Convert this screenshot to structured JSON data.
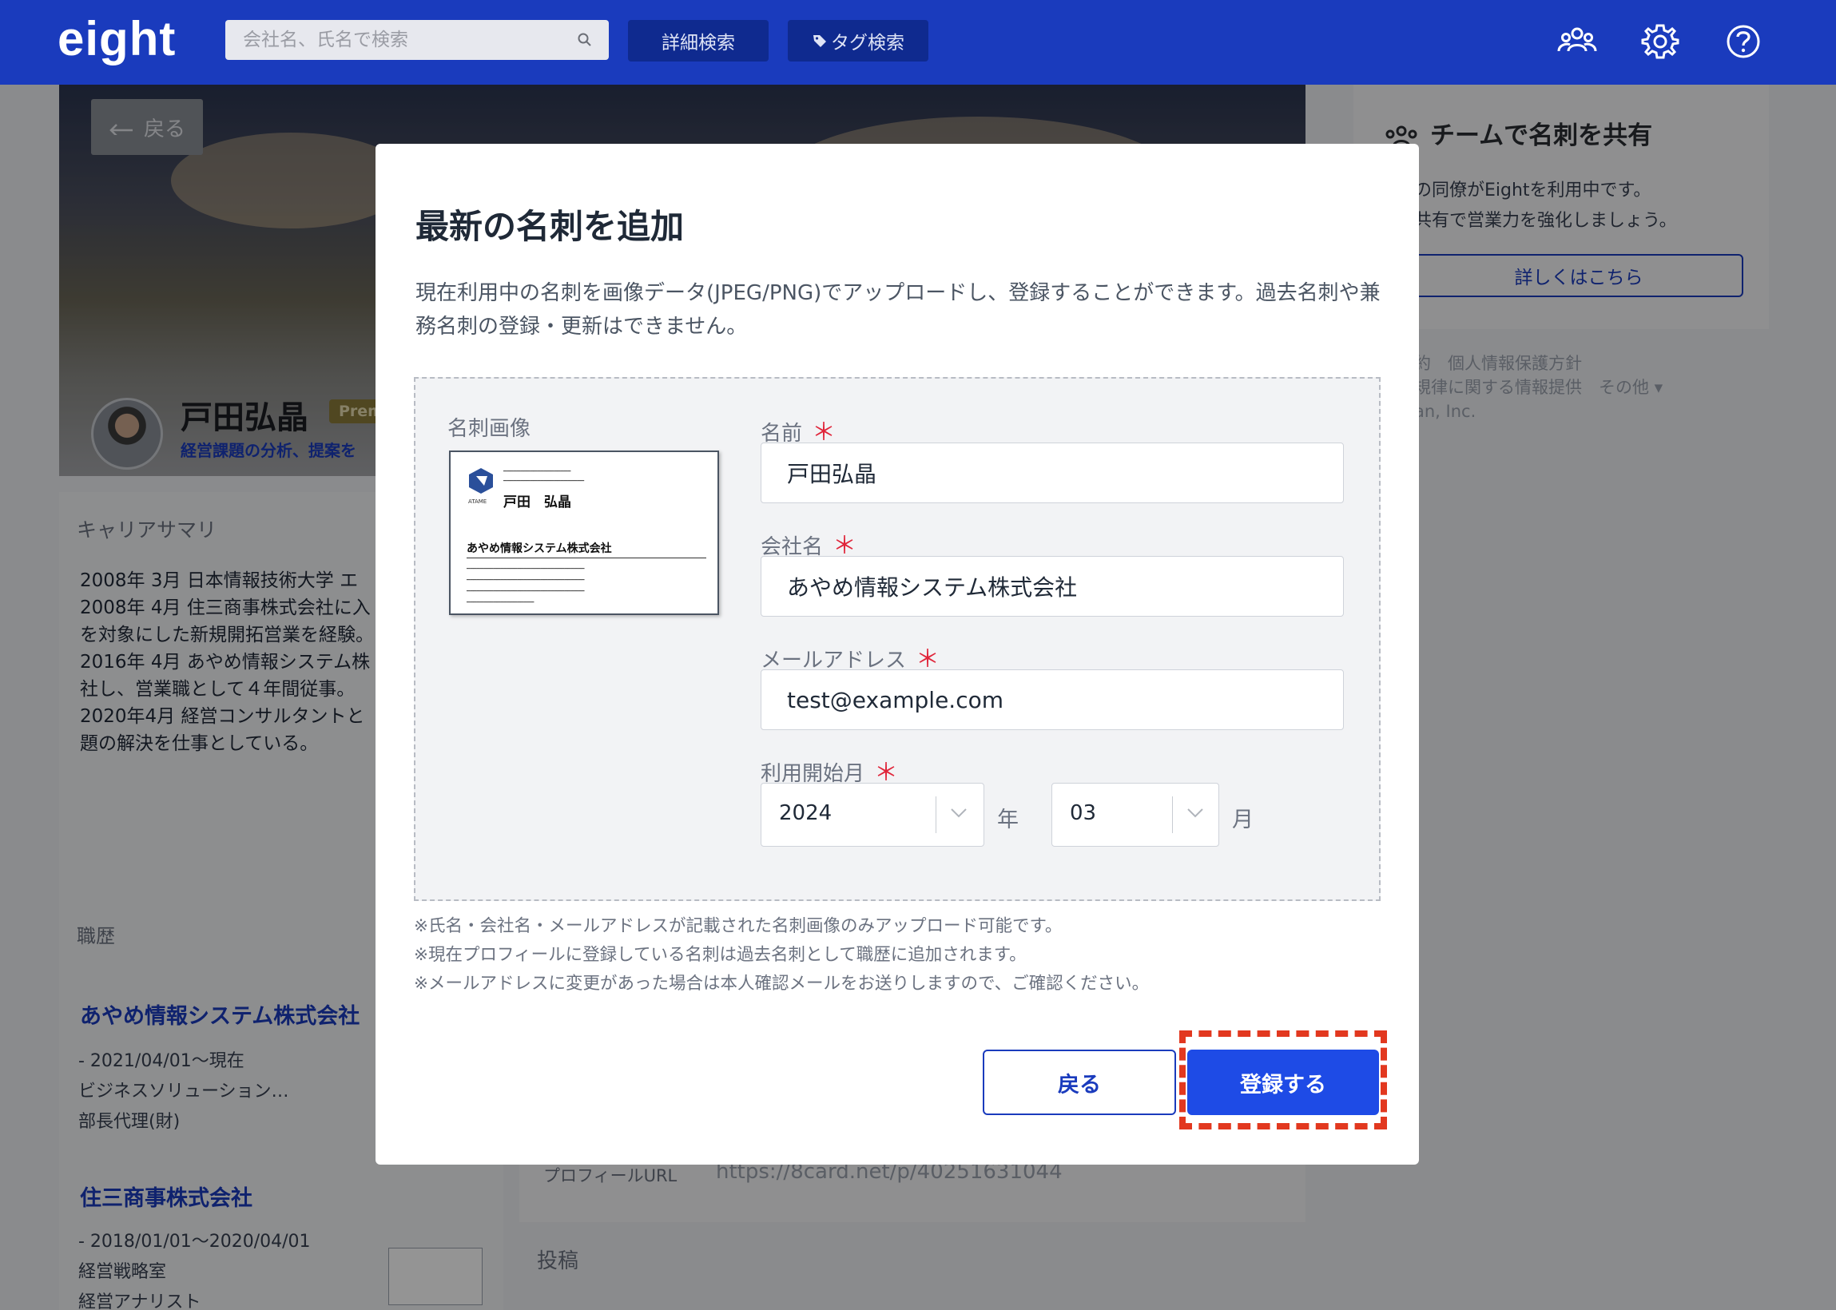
{
  "header": {
    "logo": "eight",
    "search_placeholder": "会社名、氏名で検索",
    "detail_search": "詳細検索",
    "tag_search": "タグ検索",
    "icons": [
      "team-icon",
      "gear-icon",
      "help-icon"
    ]
  },
  "profile": {
    "back_label": "戻る",
    "name": "戸田弘晶",
    "badge": "Prem",
    "tagline": "経営課題の分析、提案を",
    "career_summary_heading": "キャリアサマリ",
    "career_summary_text": "2008年 3月 日本情報技術大学 エ\n2008年 4月 住三商事株式会社に入\nを対象にした新規開拓営業を経験。\n2016年 4月 あやめ情報システム株\n社し、営業職として４年間従事。\n2020年4月 経営コンサルタントと\n題の解決を仕事としている。",
    "career_heading": "職歴",
    "companies": [
      {
        "name": "あやめ情報システム株式会社",
        "info": "- 2021/04/01〜現在\n   ビジネスソリューション…\n   部長代理(財)"
      },
      {
        "name": "住三商事株式会社",
        "info": "- 2018/01/01〜2020/04/01\n   経営戦略室\n   経営アナリスト"
      }
    ],
    "profile_url_label": "プロフィールURL",
    "profile_url": "https://8card.net/p/40251631044",
    "posts_heading": "投稿"
  },
  "sidebar": {
    "title": "チームで名刺を共有",
    "text": "の同僚がEightを利用中です。\n共有で営業力を強化しましょう。",
    "button": "詳しくはこちら",
    "footer": "約　個人情報保護方針\n規律に関する情報提供　その他 ▾\nan, Inc."
  },
  "modal": {
    "title": "最新の名刺を追加",
    "description": "現在利用中の名刺を画像データ(JPEG/PNG)でアップロードし、登録することができます。過去名刺や兼務名刺の登録・更新はできません。",
    "image_label": "名刺画像",
    "card_preview": {
      "name": "戸田　弘晶",
      "company": "あやめ情報システム株式会社",
      "brand": "ATAME"
    },
    "fields": {
      "name_label": "名前",
      "name_value": "戸田弘晶",
      "company_label": "会社名",
      "company_value": "あやめ情報システム株式会社",
      "email_label": "メールアドレス",
      "email_value": "test@example.com",
      "start_label": "利用開始月",
      "year_value": "2024",
      "year_unit": "年",
      "month_value": "03",
      "month_unit": "月",
      "required_mark": "＊"
    },
    "notes": [
      "※氏名・会社名・メールアドレスが記載された名刺画像のみアップロード可能です。",
      "※現在プロフィールに登録している名刺は過去名刺として職歴に追加されます。",
      "※メールアドレスに変更があった場合は本人確認メールをお送りしますので、ご確認ください。"
    ],
    "back_button": "戻る",
    "register_button": "登録する"
  },
  "colors": {
    "brand": "#1a3bbd",
    "primary_button": "#1e4be6",
    "required": "#e0253a",
    "highlight": "#e2381f"
  }
}
